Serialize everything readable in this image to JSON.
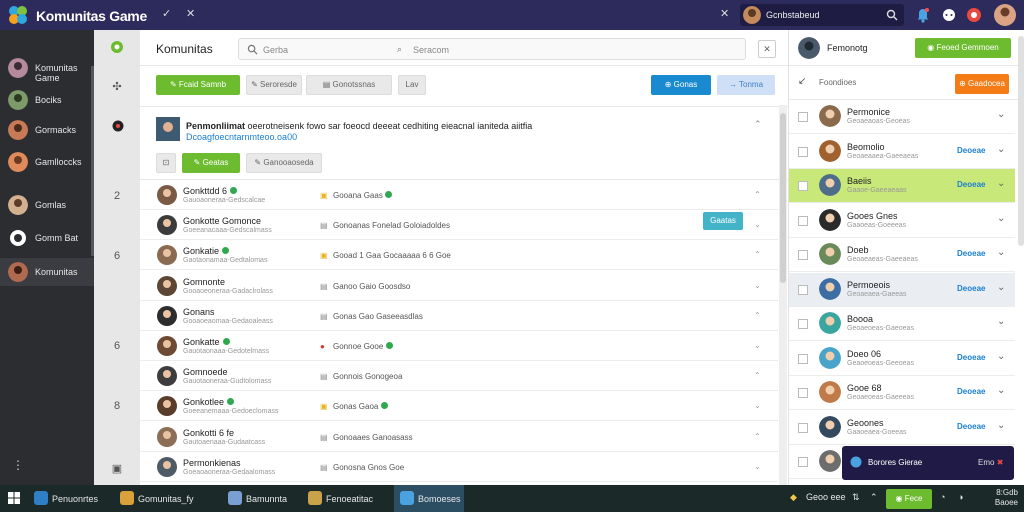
{
  "app": {
    "title": "Komunitas Game"
  },
  "topbar": {
    "user_name": "Gcnbstabeud"
  },
  "sidebar": {
    "items": [
      {
        "label": "Komunitas Game"
      },
      {
        "label": "Bociks"
      },
      {
        "label": "Gormacks"
      },
      {
        "label": "Gamlloccks"
      },
      {
        "label": "Gomlas"
      },
      {
        "label": "Gomm Bat"
      },
      {
        "label": "Komunitas"
      }
    ]
  },
  "main": {
    "title": "Komunitas",
    "search_placeholder_1": "Gerba",
    "search_placeholder_2": "Seracom",
    "toolbar": {
      "btn1": "Fcaid Samnb",
      "btn2": "Seroresde",
      "btn3": "Gonotssnas",
      "btn4": "Lav",
      "btn5": "Gonas",
      "btn6": "Tonma"
    },
    "post": {
      "author": "Penmonliimat",
      "text": "oeerotneisenk fowo sar foeocd deeeat cedhiting eieacnal ianiteda aiitfia",
      "link": "Dcoagfoecntarnmteoo.oa00",
      "btn_like": "Geatas",
      "btn_share": "Ganooaoseda"
    },
    "gutter_numbers": [
      "2",
      "6",
      "6",
      "8"
    ],
    "rows": [
      {
        "name": "Gonkttdd 6",
        "online": true,
        "sub": "Gauoaoneraa-Gedscalcae",
        "text": "Gooana Gaas",
        "icon": "trophy",
        "status": true,
        "btn": ""
      },
      {
        "name": "Gonkotte Gomonce",
        "online": false,
        "sub": "Goeeanacaaa-Gedscalmass",
        "text": "Gonoanas Fonelad Goloiadoldes",
        "icon": "chat",
        "status": false,
        "btn": "Gaatas"
      },
      {
        "name": "Gonkatie",
        "online": true,
        "sub": "Gaotaonamaa-Gedtalomas",
        "text": "Gooad 1 Gaa Gocaaaaa 6 6 Goe",
        "icon": "trophy",
        "status": false,
        "btn": ""
      },
      {
        "name": "Gomnonte",
        "online": false,
        "sub": "Gooaoeoneraa-Gadaclrolass",
        "text": "Ganoo Gaio Goosdso",
        "icon": "chat",
        "status": false,
        "btn": ""
      },
      {
        "name": "Gonans",
        "online": false,
        "sub": "Gooaoeaomaa-Gedaoaleass",
        "text": "Gonas Gao Gaseeasdlas",
        "icon": "chat",
        "status": false,
        "btn": ""
      },
      {
        "name": "Gonkatte",
        "online": true,
        "sub": "Gauotaonaaa-Gedotelmass",
        "text": "Gonnoe Gooe",
        "icon": "heart",
        "status": true,
        "btn": ""
      },
      {
        "name": "Gomnoede",
        "online": false,
        "sub": "Gauotaoneraa-Gudtolomass",
        "text": "Gonnois Gonogeoa",
        "icon": "chat",
        "status": false,
        "btn": ""
      },
      {
        "name": "Gonkotlee",
        "online": true,
        "sub": "Goeeanemaaa-Gedoeclomass",
        "text": "Gonas Gaoa",
        "icon": "trophy",
        "status": true,
        "btn": ""
      },
      {
        "name": "Gonkotti 6 fe",
        "online": false,
        "sub": "Gautoaenaaa-Gudaatcass",
        "text": "Gonoaaes Ganoasass",
        "icon": "chat",
        "status": false,
        "btn": ""
      },
      {
        "name": "Permonkienas",
        "online": false,
        "sub": "Goeaoaoneraa-Gedaalomass",
        "text": "Gonosna Gnos Goe",
        "icon": "chat",
        "status": false,
        "btn": ""
      }
    ]
  },
  "right": {
    "title": "Femonotg",
    "top_button": "Feoed Gemmoen",
    "sub_label": "Foondioes",
    "orange_button": "Gaadocea",
    "items": [
      {
        "name": "Permonice",
        "sub": "Geoaeaoas-Geoeas",
        "action": "",
        "state": ""
      },
      {
        "name": "Beomolio",
        "sub": "Geoaeaaea-Gaeeaeas",
        "action": "Deoeae",
        "state": ""
      },
      {
        "name": "Baeiis",
        "sub": "Gaaoe-Gaeeaeaas",
        "action": "Deoeae",
        "state": "hl"
      },
      {
        "name": "Gooes Gnes",
        "sub": "Gaaoeas-Goeeeas",
        "action": "",
        "state": ""
      },
      {
        "name": "Doeb",
        "sub": "Geoaeaeas-Gaeeaeas",
        "action": "Deoeae",
        "state": ""
      },
      {
        "name": "Permoeois",
        "sub": "Geoaeaea-Gaeeas",
        "action": "Deoeae",
        "state": "sel"
      },
      {
        "name": "Boooa",
        "sub": "Geoaeoeas-Gaeoeas",
        "action": "",
        "state": ""
      },
      {
        "name": "Doeo 06",
        "sub": "Geaoeoeas-Geeoeas",
        "action": "Deoeae",
        "state": ""
      },
      {
        "name": "Gooe 68",
        "sub": "Geoaeoeas-Gaeeeas",
        "action": "Deoeae",
        "state": ""
      },
      {
        "name": "Geoones",
        "sub": "Gaaoeaea-Goeeas",
        "action": "Deoeae",
        "state": ""
      },
      {
        "name": "Bocma",
        "sub": "Geoaeaeas-Gaeeas",
        "action": "",
        "state": ""
      }
    ],
    "toast": {
      "text": "Borores Gierae",
      "close": "Emo"
    }
  },
  "taskbar": {
    "items": [
      "Penuonrtes",
      "Gomunitas_fy",
      "Bamunnta",
      "Fenoeatitac",
      "Bomoeses"
    ],
    "tray_text": "Geoo eee",
    "tray_button": "Fece",
    "clock_time": "8:Gdb",
    "clock_date": "Baoee"
  },
  "colors": {
    "topbar": "#2d2a5c",
    "sidebar": "#2b2d31",
    "accent_green": "#6dbb2e",
    "accent_blue": "#1a8ad0",
    "accent_orange": "#f47b16",
    "highlight_row": "#c8e87a",
    "taskbar": "#1b2a29"
  },
  "icons": [
    "logo-icon",
    "chevron-icon",
    "close-icon",
    "search-icon",
    "bell-icon",
    "chat-icon",
    "settings-icon",
    "trophy-icon",
    "heart-icon",
    "windows-icon"
  ]
}
